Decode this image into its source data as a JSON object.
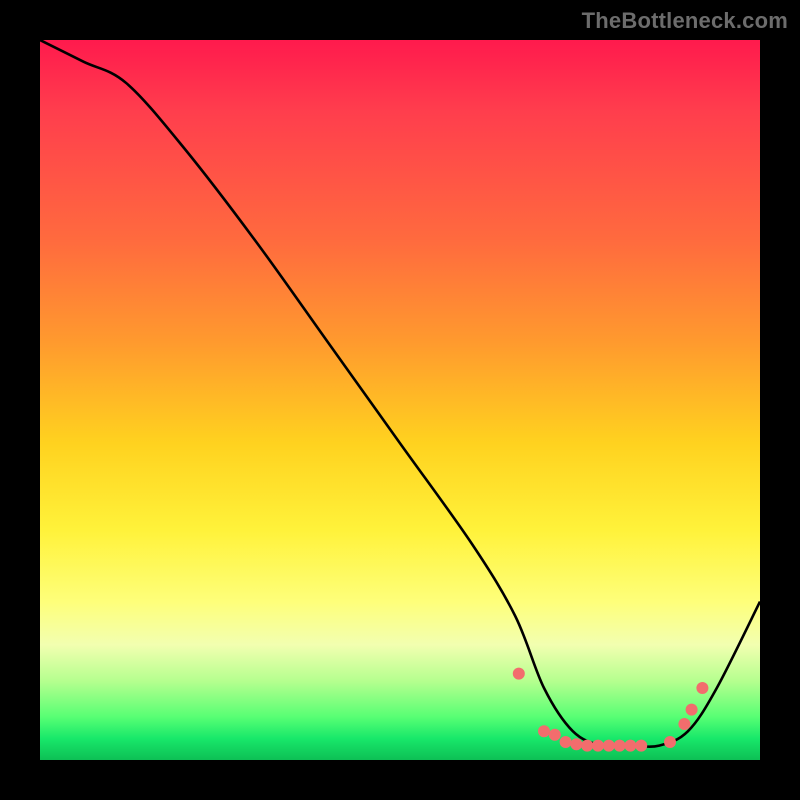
{
  "watermark": "TheBottleneck.com",
  "chart_data": {
    "type": "line",
    "title": "",
    "xlabel": "",
    "ylabel": "",
    "xlim": [
      0,
      100
    ],
    "ylim": [
      0,
      100
    ],
    "series": [
      {
        "name": "curve",
        "x": [
          0,
          6,
          12,
          20,
          30,
          40,
          50,
          60,
          66,
          70,
          74,
          78,
          82,
          86,
          90,
          94,
          100
        ],
        "y": [
          100,
          97,
          94,
          85,
          72,
          58,
          44,
          30,
          20,
          10,
          4,
          2,
          2,
          2,
          4,
          10,
          22
        ]
      }
    ],
    "markers": {
      "name": "dots",
      "x": [
        66.5,
        70.0,
        71.5,
        73.0,
        74.5,
        76.0,
        77.5,
        79.0,
        80.5,
        82.0,
        83.5,
        87.5,
        89.5,
        90.5,
        92.0
      ],
      "y": [
        12.0,
        4.0,
        3.5,
        2.5,
        2.2,
        2.0,
        2.0,
        2.0,
        2.0,
        2.0,
        2.0,
        2.5,
        5.0,
        7.0,
        10.0
      ],
      "color": "#f26d6d",
      "radius_px": 6
    },
    "gradient_stops": [
      {
        "pos": 0.0,
        "color": "#ff1a4d"
      },
      {
        "pos": 0.1,
        "color": "#ff3e4d"
      },
      {
        "pos": 0.28,
        "color": "#ff6b3e"
      },
      {
        "pos": 0.42,
        "color": "#ff9a2e"
      },
      {
        "pos": 0.56,
        "color": "#ffd21f"
      },
      {
        "pos": 0.68,
        "color": "#fff23a"
      },
      {
        "pos": 0.78,
        "color": "#feff7a"
      },
      {
        "pos": 0.84,
        "color": "#f2ffb0"
      },
      {
        "pos": 0.89,
        "color": "#b6ff8f"
      },
      {
        "pos": 0.94,
        "color": "#58ff74"
      },
      {
        "pos": 0.97,
        "color": "#18e86a"
      },
      {
        "pos": 1.0,
        "color": "#0dbf55"
      }
    ]
  }
}
